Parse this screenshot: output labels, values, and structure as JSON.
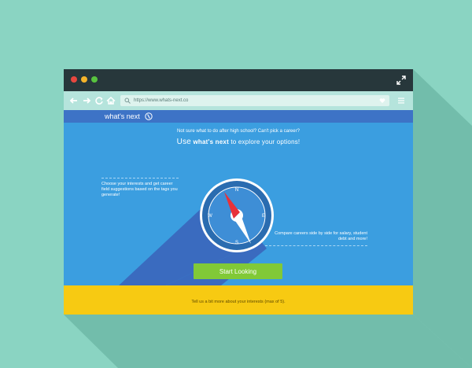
{
  "browser": {
    "url": "https://www.whats-next.co",
    "icons": {
      "close": "red-dot",
      "minimize": "yellow-dot",
      "maximize": "green-dot",
      "expand": "expand-arrows-icon",
      "back": "arrow-left-icon",
      "forward": "arrow-right-icon",
      "reload": "reload-icon",
      "home": "home-icon",
      "search": "search-icon",
      "favorite": "heart-icon",
      "menu": "hamburger-icon"
    }
  },
  "site": {
    "logo_text": "what's next",
    "logo_icon": "compass-slash-icon"
  },
  "hero": {
    "lead": "Not sure what to do after high school? Can't pick a career?",
    "headline": {
      "use": "Use",
      "brand": "what's next",
      "rest": "to explore your options!"
    },
    "note_left": "Choose your interests and get career field suggestions based on the tags you generate!",
    "note_right": "Compare careers side by side for salary, student debt and more!",
    "compass": {
      "n": "N",
      "e": "E",
      "s": "S",
      "w": "W"
    },
    "cta_label": "Start Looking"
  },
  "footer": {
    "text": "Tell us a bit more about your interests (max of 5)."
  },
  "colors": {
    "background": "#8ad4c2",
    "titlebar": "#27373b",
    "toolbar": "#b5e4dc",
    "header": "#3d73c6",
    "hero": "#3b9ee0",
    "cta": "#81c937",
    "footer": "#f7ca12",
    "needle": "#e8313a"
  }
}
